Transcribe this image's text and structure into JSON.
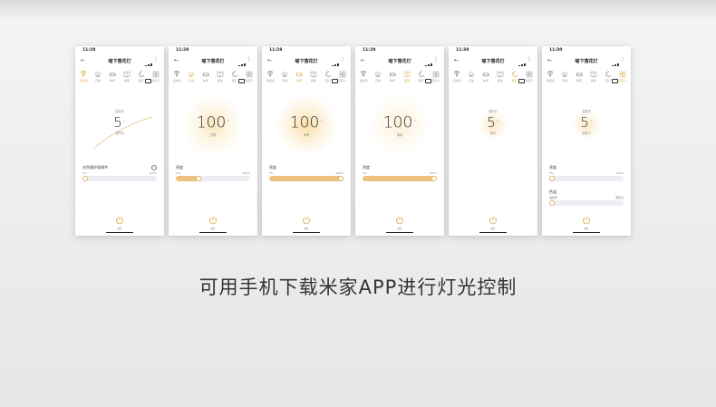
{
  "caption": "可用手机下载米家APP进行灯光控制",
  "colors": {
    "accent": "#e0a84a",
    "track": "#eceef4",
    "fill": "#ecc27e"
  },
  "phones": [
    {
      "time": "11:28",
      "title": "喻下落花灯",
      "modes": [
        {
          "icon": "diamond-icon",
          "label": "自然光"
        },
        {
          "icon": "house-icon",
          "label": "日常"
        },
        {
          "icon": "sofa-icon",
          "label": "休闲"
        },
        {
          "icon": "book-icon",
          "label": "阅读"
        },
        {
          "icon": "moon-icon",
          "label": "夜灯"
        },
        {
          "icon": "grid-icon",
          "label": "自定义"
        }
      ],
      "active_mode": 0,
      "top_label": "自然光",
      "value": "5",
      "unit": "%",
      "mode_name": "自然光",
      "sections": [
        {
          "title": "光色随环境调节",
          "min": "5%",
          "max": "100%",
          "fraction": 0.0,
          "help": true
        }
      ],
      "power_label": "关灯"
    },
    {
      "time": "11:28",
      "title": "喻下落花灯",
      "modes": [
        {
          "icon": "diamond-icon",
          "label": "自然光"
        },
        {
          "icon": "house-icon",
          "label": "日常"
        },
        {
          "icon": "sofa-icon",
          "label": "休闲"
        },
        {
          "icon": "book-icon",
          "label": "阅读"
        },
        {
          "icon": "moon-icon",
          "label": "夜灯"
        },
        {
          "icon": "grid-icon",
          "label": "自定义"
        }
      ],
      "active_mode": 1,
      "top_label": "",
      "value": "100",
      "unit": "%",
      "mode_name": "日常",
      "sections": [
        {
          "title": "亮度",
          "min": "5%",
          "max": "100%",
          "fraction": 0.3,
          "help": false
        }
      ],
      "power_label": "关灯"
    },
    {
      "time": "11:28",
      "title": "喻下落花灯",
      "modes": [
        {
          "icon": "diamond-icon",
          "label": "自然光"
        },
        {
          "icon": "house-icon",
          "label": "日常"
        },
        {
          "icon": "sofa-icon",
          "label": "休闲"
        },
        {
          "icon": "book-icon",
          "label": "阅读"
        },
        {
          "icon": "moon-icon",
          "label": "夜灯"
        },
        {
          "icon": "grid-icon",
          "label": "自定义"
        }
      ],
      "active_mode": 2,
      "top_label": "",
      "value": "100",
      "unit": "%",
      "mode_name": "休闲",
      "sections": [
        {
          "title": "亮度",
          "min": "5%",
          "max": "100%",
          "fraction": 1.0,
          "help": false
        }
      ],
      "power_label": "关灯"
    },
    {
      "time": "11:29",
      "title": "喻下落花灯",
      "modes": [
        {
          "icon": "diamond-icon",
          "label": "自然光"
        },
        {
          "icon": "house-icon",
          "label": "日常"
        },
        {
          "icon": "sofa-icon",
          "label": "休闲"
        },
        {
          "icon": "book-icon",
          "label": "阅读"
        },
        {
          "icon": "moon-icon",
          "label": "夜灯"
        },
        {
          "icon": "grid-icon",
          "label": "自定义"
        }
      ],
      "active_mode": 3,
      "top_label": "",
      "value": "100",
      "unit": "%",
      "mode_name": "阅读",
      "sections": [
        {
          "title": "亮度",
          "min": "5%",
          "max": "100%",
          "fraction": 1.0,
          "help": false
        }
      ],
      "power_label": "关灯"
    },
    {
      "time": "11:30",
      "title": "喻下落花灯",
      "modes": [
        {
          "icon": "diamond-icon",
          "label": "自然光"
        },
        {
          "icon": "house-icon",
          "label": "日常"
        },
        {
          "icon": "sofa-icon",
          "label": "休闲"
        },
        {
          "icon": "book-icon",
          "label": "阅读"
        },
        {
          "icon": "moon-icon",
          "label": "夜灯"
        },
        {
          "icon": "grid-icon",
          "label": "自定义"
        }
      ],
      "active_mode": 4,
      "top_label": "夜灯灯",
      "value": "5",
      "unit": "%",
      "mode_name": "夜灯",
      "sections": [],
      "power_label": "关灯"
    },
    {
      "time": "11:30",
      "title": "喻下落花灯",
      "modes": [
        {
          "icon": "diamond-icon",
          "label": "自然光"
        },
        {
          "icon": "house-icon",
          "label": "日常"
        },
        {
          "icon": "sofa-icon",
          "label": "休闲"
        },
        {
          "icon": "book-icon",
          "label": "阅读"
        },
        {
          "icon": "moon-icon",
          "label": "夜灯"
        },
        {
          "icon": "grid-icon",
          "label": "自定义"
        }
      ],
      "active_mode": 5,
      "top_label": "自然光",
      "value": "5",
      "unit": "%",
      "mode_name": "自定义",
      "sections": [
        {
          "title": "亮度",
          "min": "5%",
          "max": "100%",
          "fraction": 0.0,
          "help": false
        },
        {
          "title": "色温",
          "min": "温暖黄",
          "max": "明亮白",
          "fraction": 0.0,
          "help": false
        }
      ],
      "power_label": "关灯"
    }
  ]
}
